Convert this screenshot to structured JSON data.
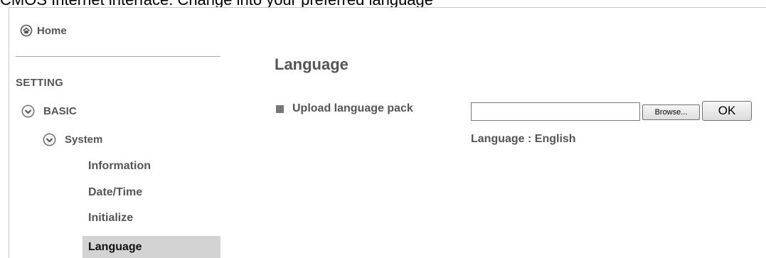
{
  "top_text": "CMOS Internet interface. Change into your preferred language",
  "sidebar": {
    "home_label": "Home",
    "section_label": "SETTING",
    "basic_label": "BASIC",
    "system_label": "System",
    "items": [
      {
        "label": "Information"
      },
      {
        "label": "Date/Time"
      },
      {
        "label": "Initialize"
      },
      {
        "label": "Language"
      }
    ],
    "active_item": "Language"
  },
  "main": {
    "title": "Language",
    "upload_label": "Upload language pack",
    "file_value": "",
    "browse_label": "Browse...",
    "ok_label": "OK",
    "language_status": "Language : English"
  },
  "icons": {
    "home": "home-icon",
    "basic": "chevron-down-circle-icon",
    "system": "chevron-down-circle-icon",
    "bullet": "square-bullet-icon"
  },
  "colors": {
    "text": "#555555",
    "active_bg": "#d3d3d3",
    "separator": "#aaaaaa"
  }
}
